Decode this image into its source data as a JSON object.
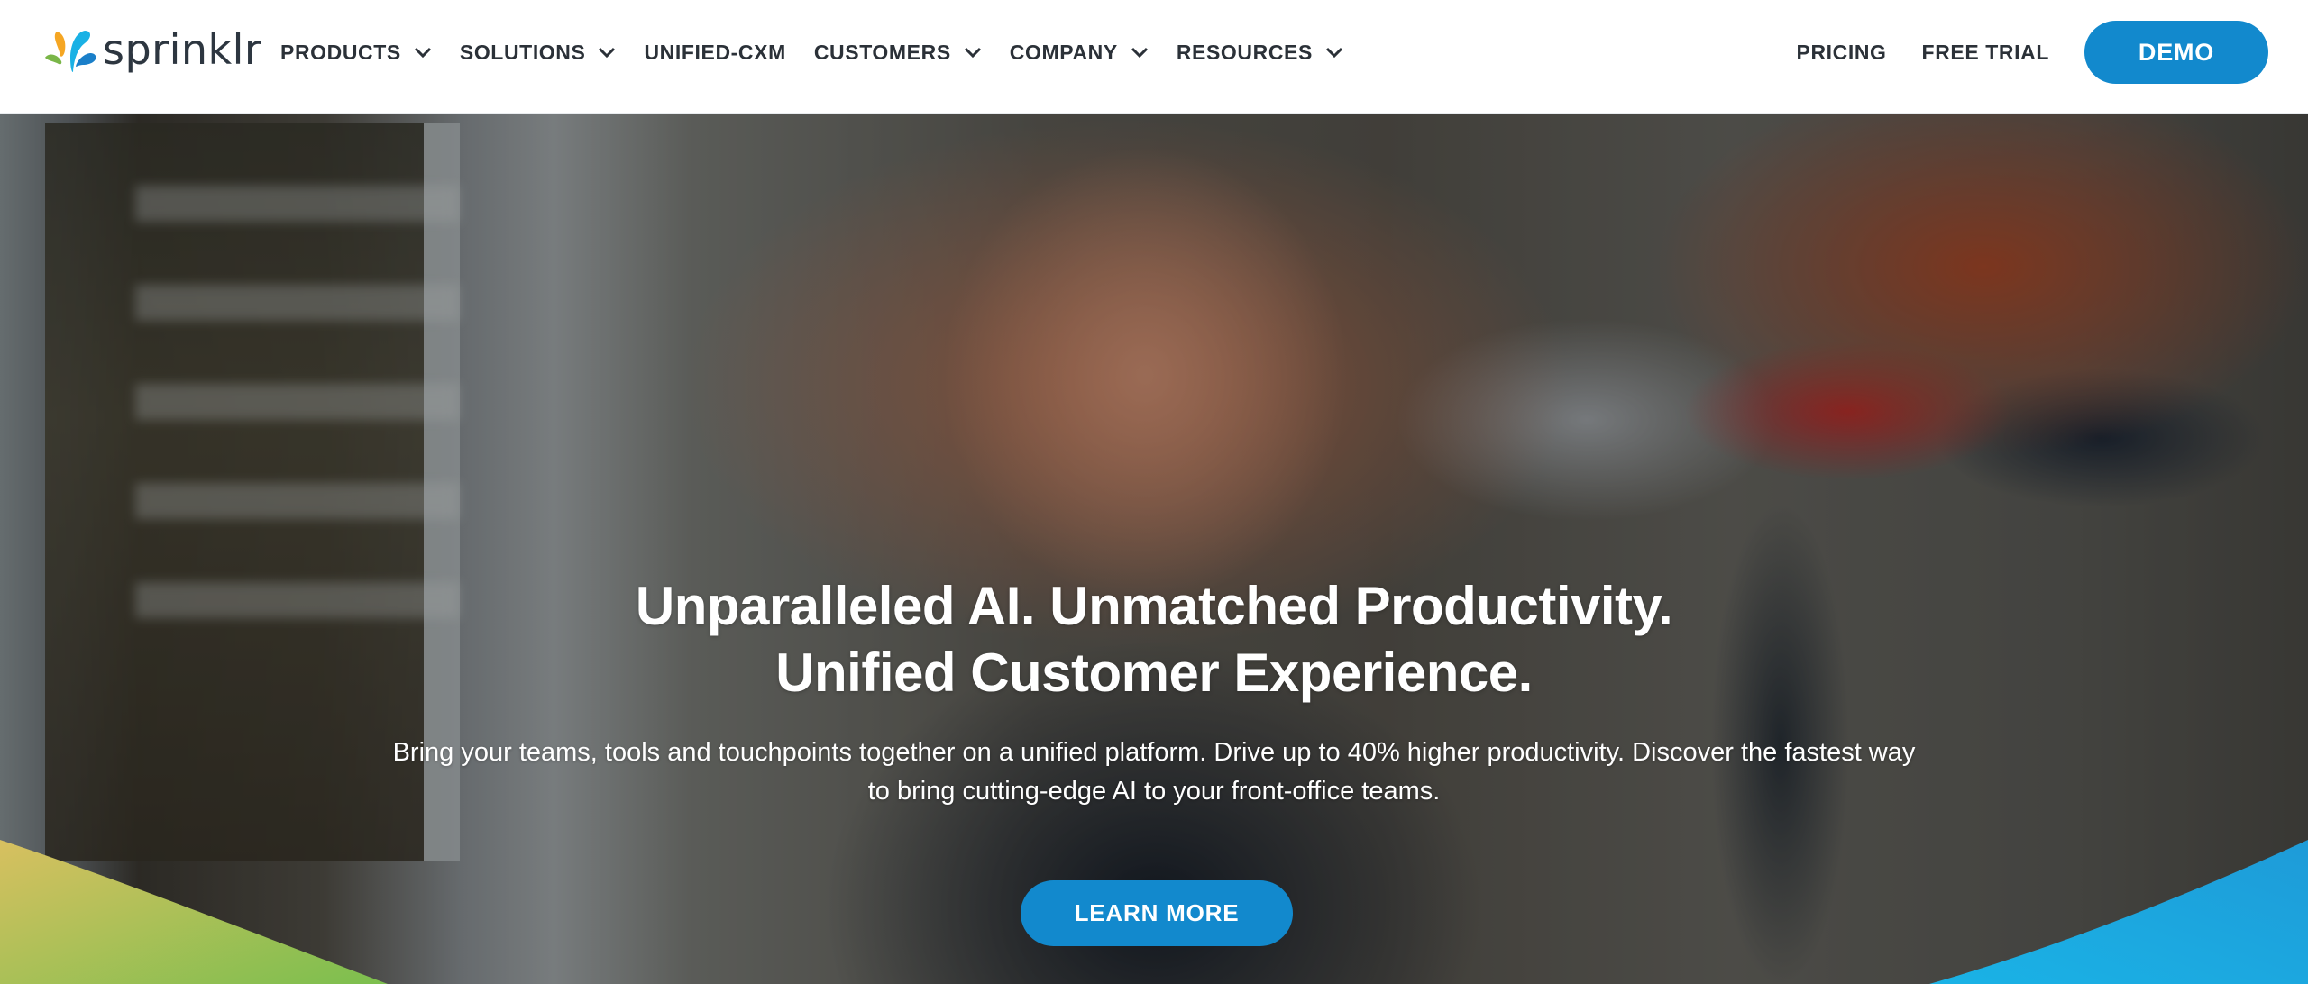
{
  "header": {
    "logo": {
      "text": "sprinklr",
      "icon": "sprinklr-droplets-logo",
      "colors": [
        "#f5a623",
        "#7ab648",
        "#1ab1e5",
        "#1a7fc9"
      ]
    },
    "nav": [
      {
        "label": "PRODUCTS",
        "has_dropdown": true
      },
      {
        "label": "SOLUTIONS",
        "has_dropdown": true
      },
      {
        "label": "UNIFIED-CXM",
        "has_dropdown": false
      },
      {
        "label": "CUSTOMERS",
        "has_dropdown": true
      },
      {
        "label": "COMPANY",
        "has_dropdown": true
      },
      {
        "label": "RESOURCES",
        "has_dropdown": true
      }
    ],
    "right_links": [
      {
        "label": "PRICING"
      },
      {
        "label": "FREE TRIAL"
      }
    ],
    "demo_button": "DEMO"
  },
  "hero": {
    "title_line1": "Unparalleled AI. Unmatched Productivity.",
    "title_line2": "Unified Customer Experience.",
    "subtitle_line1": "Bring your teams, tools and touchpoints together on a unified platform. Drive up to 40% higher productivity. Discover the fastest way",
    "subtitle_line2": "to bring cutting-edge AI to your front-office teams.",
    "cta_label": "LEARN MORE",
    "background_image": "woman-with-windblown-pink-hair-on-street"
  },
  "colors": {
    "accent": "#1289cd",
    "nav_text": "#2b3138",
    "swoosh_left": [
      "#d8c060",
      "#7bbf4e"
    ],
    "swoosh_right": [
      "#1ab3e6",
      "#1e9bd8"
    ]
  }
}
